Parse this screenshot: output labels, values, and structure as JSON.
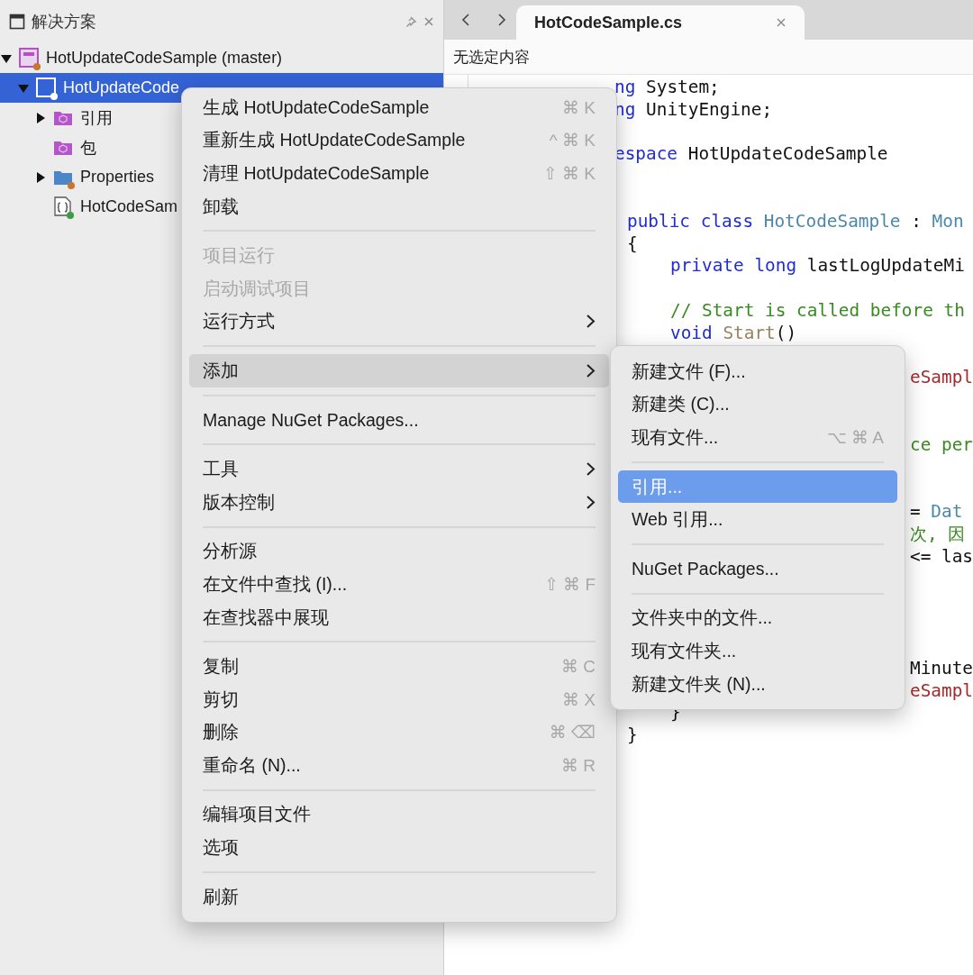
{
  "solution_panel": {
    "title": "解决方案",
    "tree": [
      {
        "label": "HotUpdateCodeSample (master)",
        "kind": "solution",
        "expanded": true,
        "selected": false,
        "children": [
          {
            "label": "HotUpdateCode",
            "kind": "project",
            "expanded": true,
            "selected": true,
            "children": [
              {
                "label": "引用",
                "kind": "references",
                "expanded": false,
                "selected": false
              },
              {
                "label": "包",
                "kind": "packages",
                "selected": false
              },
              {
                "label": "Properties",
                "kind": "folder",
                "expanded": false,
                "selected": false
              },
              {
                "label": "HotCodeSam",
                "kind": "csfile",
                "selected": false
              }
            ]
          }
        ]
      }
    ]
  },
  "editor": {
    "tabs": [
      {
        "label": "HotCodeSample.cs",
        "selected": true
      }
    ],
    "breadcrumb": "无选定内容",
    "lines": [
      {
        "kind": "menu-edge",
        "segments": [
          {
            "kind": "keyword",
            "text": "ng"
          },
          {
            "kind": "plain",
            "text": " System;"
          }
        ]
      },
      {
        "kind": "menu-edge",
        "segments": [
          {
            "kind": "keyword",
            "text": "ng"
          },
          {
            "kind": "plain",
            "text": " UnityEngine;"
          }
        ]
      },
      {
        "kind": "blank"
      },
      {
        "kind": "menu-edge",
        "segments": [
          {
            "kind": "keyword",
            "text": "espace"
          },
          {
            "kind": "plain",
            "text": " HotUpdateCodeSample"
          }
        ]
      },
      {
        "kind": "blank"
      },
      {
        "kind": "blank"
      },
      {
        "kind": "level1",
        "segments": [
          {
            "kind": "keyword",
            "text": "public class "
          },
          {
            "kind": "type",
            "text": "HotCodeSample"
          },
          {
            "kind": "plain",
            "text": " : "
          },
          {
            "kind": "type",
            "text": "Mon"
          }
        ]
      },
      {
        "kind": "level1",
        "segments": [
          {
            "kind": "plain",
            "text": "{"
          }
        ]
      },
      {
        "kind": "level2",
        "segments": [
          {
            "kind": "keyword",
            "text": "private long"
          },
          {
            "kind": "plain",
            "text": " lastLogUpdateMi"
          }
        ]
      },
      {
        "kind": "blank"
      },
      {
        "kind": "level2",
        "segments": [
          {
            "kind": "comment",
            "text": "// Start is called before th"
          }
        ]
      },
      {
        "kind": "level2",
        "segments": [
          {
            "kind": "keyword",
            "text": "void "
          },
          {
            "kind": "method",
            "text": "Start"
          },
          {
            "kind": "plain",
            "text": "()"
          }
        ]
      },
      {
        "kind": "blank"
      },
      {
        "kind": "submenu-edge",
        "segments": [
          {
            "kind": "string",
            "text": "eSampl"
          }
        ]
      },
      {
        "kind": "blank"
      },
      {
        "kind": "blank"
      },
      {
        "kind": "submenu-edge",
        "segments": [
          {
            "kind": "comment",
            "text": "ce per"
          }
        ]
      },
      {
        "kind": "blank"
      },
      {
        "kind": "blank"
      },
      {
        "kind": "submenu-edge",
        "segments": [
          {
            "kind": "plain",
            "text": "= "
          },
          {
            "kind": "type",
            "text": "Dat"
          }
        ]
      },
      {
        "kind": "submenu-edge",
        "segments": [
          {
            "kind": "comment",
            "text": "次, 因"
          }
        ]
      },
      {
        "kind": "submenu-edge",
        "segments": [
          {
            "kind": "plain",
            "text": "<= las"
          }
        ]
      },
      {
        "kind": "blank"
      },
      {
        "kind": "blank"
      },
      {
        "kind": "blank"
      },
      {
        "kind": "blank"
      },
      {
        "kind": "submenu-edge",
        "segments": [
          {
            "kind": "plain",
            "text": "Minute"
          }
        ]
      },
      {
        "kind": "submenu-edge",
        "segments": [
          {
            "kind": "string",
            "text": "eSampl"
          }
        ]
      },
      {
        "kind": "level2",
        "segments": [
          {
            "kind": "plain",
            "text": "}"
          }
        ]
      },
      {
        "kind": "level1",
        "segments": [
          {
            "kind": "plain",
            "text": "}"
          }
        ]
      }
    ]
  },
  "context_menu": {
    "focused": false,
    "items": [
      {
        "kind": "item",
        "label": "生成 HotUpdateCodeSample",
        "shortcut": "⌘ K",
        "disabled": false,
        "submenu": false,
        "selected": false
      },
      {
        "kind": "item",
        "label": "重新生成 HotUpdateCodeSample",
        "shortcut": "^ ⌘ K",
        "disabled": false,
        "submenu": false,
        "selected": false
      },
      {
        "kind": "item",
        "label": "清理 HotUpdateCodeSample",
        "shortcut": "⇧ ⌘ K",
        "disabled": false,
        "submenu": false,
        "selected": false
      },
      {
        "kind": "item",
        "label": "卸载",
        "disabled": false,
        "submenu": false,
        "selected": false
      },
      {
        "kind": "separator"
      },
      {
        "kind": "item",
        "label": "项目运行",
        "disabled": true,
        "submenu": false,
        "selected": false
      },
      {
        "kind": "item",
        "label": "启动调试项目",
        "disabled": true,
        "submenu": false,
        "selected": false
      },
      {
        "kind": "item",
        "label": "运行方式",
        "disabled": false,
        "submenu": true,
        "selected": false
      },
      {
        "kind": "separator"
      },
      {
        "kind": "item",
        "label": "添加",
        "disabled": false,
        "submenu": true,
        "selected": true
      },
      {
        "kind": "separator"
      },
      {
        "kind": "item",
        "label": "Manage NuGet Packages...",
        "disabled": false,
        "submenu": false,
        "selected": false
      },
      {
        "kind": "separator"
      },
      {
        "kind": "item",
        "label": "工具",
        "disabled": false,
        "submenu": true,
        "selected": false
      },
      {
        "kind": "item",
        "label": "版本控制",
        "disabled": false,
        "submenu": true,
        "selected": false
      },
      {
        "kind": "separator"
      },
      {
        "kind": "item",
        "label": "分析源",
        "disabled": false,
        "submenu": false,
        "selected": false
      },
      {
        "kind": "item",
        "label": "在文件中查找 (I)...",
        "shortcut": "⇧ ⌘ F",
        "disabled": false,
        "submenu": false,
        "selected": false
      },
      {
        "kind": "item",
        "label": "在查找器中展现",
        "disabled": false,
        "submenu": false,
        "selected": false
      },
      {
        "kind": "separator"
      },
      {
        "kind": "item",
        "label": "复制",
        "shortcut": "⌘ C",
        "disabled": false,
        "submenu": false,
        "selected": false
      },
      {
        "kind": "item",
        "label": "剪切",
        "shortcut": "⌘ X",
        "disabled": false,
        "submenu": false,
        "selected": false
      },
      {
        "kind": "item",
        "label": "删除",
        "shortcut": "⌘ ⌫",
        "disabled": false,
        "submenu": false,
        "selected": false
      },
      {
        "kind": "item",
        "label": "重命名 (N)...",
        "shortcut": "⌘ R",
        "disabled": false,
        "submenu": false,
        "selected": false
      },
      {
        "kind": "separator"
      },
      {
        "kind": "item",
        "label": "编辑项目文件",
        "disabled": false,
        "submenu": false,
        "selected": false
      },
      {
        "kind": "item",
        "label": "选项",
        "disabled": false,
        "submenu": false,
        "selected": false
      },
      {
        "kind": "separator"
      },
      {
        "kind": "item",
        "label": "刷新",
        "disabled": false,
        "submenu": false,
        "selected": false
      }
    ]
  },
  "add_submenu": {
    "focused": true,
    "items": [
      {
        "kind": "item",
        "label": "新建文件 (F)...",
        "disabled": false,
        "submenu": false,
        "selected": false
      },
      {
        "kind": "item",
        "label": "新建类 (C)...",
        "disabled": false,
        "submenu": false,
        "selected": false
      },
      {
        "kind": "item",
        "label": "现有文件...",
        "shortcut": "⌥ ⌘ A",
        "disabled": false,
        "submenu": false,
        "selected": false
      },
      {
        "kind": "separator"
      },
      {
        "kind": "item",
        "label": "引用...",
        "disabled": false,
        "submenu": false,
        "selected": true
      },
      {
        "kind": "item",
        "label": "Web 引用...",
        "disabled": false,
        "submenu": false,
        "selected": false
      },
      {
        "kind": "separator"
      },
      {
        "kind": "item",
        "label": "NuGet Packages...",
        "disabled": false,
        "submenu": false,
        "selected": false
      },
      {
        "kind": "separator"
      },
      {
        "kind": "item",
        "label": "文件夹中的文件...",
        "disabled": false,
        "submenu": false,
        "selected": false
      },
      {
        "kind": "item",
        "label": "现有文件夹...",
        "disabled": false,
        "submenu": false,
        "selected": false
      },
      {
        "kind": "item",
        "label": "新建文件夹 (N)...",
        "disabled": false,
        "submenu": false,
        "selected": false
      }
    ]
  }
}
